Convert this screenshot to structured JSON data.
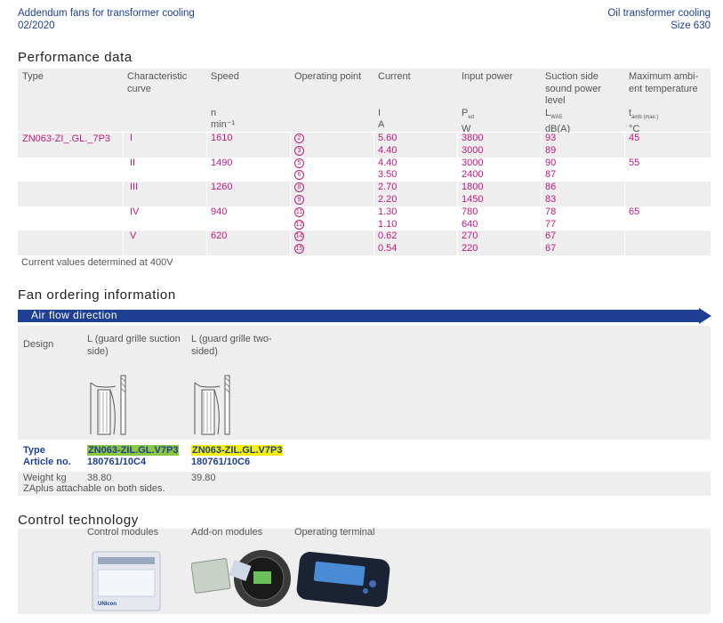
{
  "header": {
    "left_line1": "Addendum fans for transformer cooling",
    "left_line2": "02/2020",
    "right_line1": "Oil transformer cooling",
    "right_line2": "Size 630"
  },
  "performance": {
    "title": "Performance data",
    "columns": [
      {
        "label": "Type",
        "unit1": "",
        "unit2": ""
      },
      {
        "label": "Characteristic curve",
        "unit1": "",
        "unit2": ""
      },
      {
        "label": "Speed",
        "unit1": "n",
        "unit2": "min⁻¹"
      },
      {
        "label": "Operating point",
        "unit1": "",
        "unit2": ""
      },
      {
        "label": "Current",
        "unit1": "I",
        "unit2": "A"
      },
      {
        "label": "Input power",
        "unit1": "P",
        "unit1_sub": "ed",
        "unit2": "W"
      },
      {
        "label": "Suction side sound power level",
        "unit1": "L",
        "unit1_sub": "WA5",
        "unit2": "dB(A)"
      },
      {
        "label": "Maximum ambi-ent temperature",
        "unit1": "t",
        "unit1_sub": "amb (max.)",
        "unit2": "°C"
      }
    ],
    "type_value": "ZN063-ZI_.GL._7P3",
    "rows": [
      {
        "curve": "I",
        "speed": "1610",
        "op": "2",
        "current": "5.60",
        "power": "3800",
        "sound": "93",
        "temp": "45"
      },
      {
        "curve": "",
        "speed": "",
        "op": "3",
        "current": "4.40",
        "power": "3000",
        "sound": "89",
        "temp": ""
      },
      {
        "curve": "II",
        "speed": "1490",
        "op": "5",
        "current": "4.40",
        "power": "3000",
        "sound": "90",
        "temp": "55"
      },
      {
        "curve": "",
        "speed": "",
        "op": "6",
        "current": "3.50",
        "power": "2400",
        "sound": "87",
        "temp": ""
      },
      {
        "curve": "III",
        "speed": "1260",
        "op": "8",
        "current": "2.70",
        "power": "1800",
        "sound": "86",
        "temp": ""
      },
      {
        "curve": "",
        "speed": "",
        "op": "9",
        "current": "2.20",
        "power": "1450",
        "sound": "83",
        "temp": ""
      },
      {
        "curve": "IV",
        "speed": "940",
        "op": "11",
        "current": "1.30",
        "power": "780",
        "sound": "78",
        "temp": "65"
      },
      {
        "curve": "",
        "speed": "",
        "op": "12",
        "current": "1.10",
        "power": "640",
        "sound": "77",
        "temp": ""
      },
      {
        "curve": "V",
        "speed": "620",
        "op": "14",
        "current": "0.62",
        "power": "270",
        "sound": "67",
        "temp": ""
      },
      {
        "curve": "",
        "speed": "",
        "op": "15",
        "current": "0.54",
        "power": "220",
        "sound": "67",
        "temp": ""
      }
    ],
    "note": "Current values determined at 400V"
  },
  "ordering": {
    "title": "Fan ordering information",
    "airflow_label": "Air flow direction",
    "design_label": "Design",
    "design1": "L (guard grille suction side)",
    "design2": "L (guard grille two-sided)",
    "type_label": "Type",
    "article_label": "Article no.",
    "type1": "ZN063-ZIL.GL.V7P3",
    "type2": "ZN063-ZIL.GL.V7P3",
    "article1": "180761/10C4",
    "article2": "180761/10C6",
    "weight_label": "Weight kg",
    "weight1": "38.80",
    "weight2": "39.80",
    "zaplus": "ZAplus attachable on both sides."
  },
  "control": {
    "title": "Control technology",
    "modules": "Control modules",
    "addon": "Add-on modules",
    "terminal": "Operating terminal",
    "device_brand": "UNIcon"
  },
  "colors": {
    "brand_blue": "#1f3f93",
    "pink": "#c2187f",
    "highlight_green": "#8cc63f",
    "highlight_yellow": "#f5f000"
  }
}
